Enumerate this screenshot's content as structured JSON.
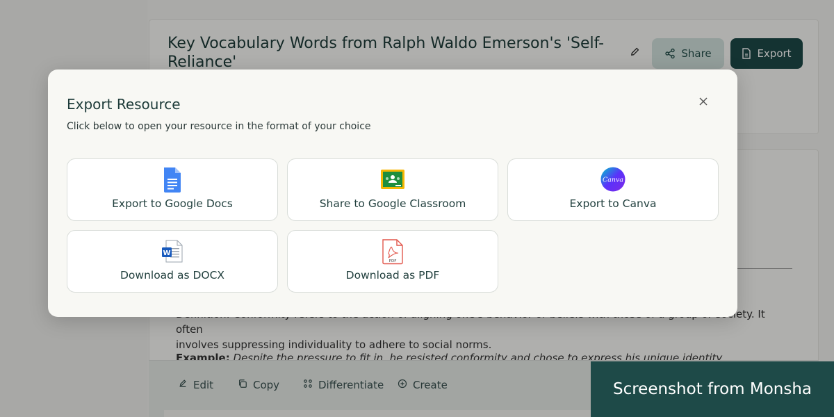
{
  "document": {
    "title": "Key Vocabulary Words from Ralph Waldo Emerson's 'Self-Reliance'",
    "share_label": "Share",
    "export_label": "Export"
  },
  "content": {
    "definition_line1": "Definition: Conformity refers to the action of aligning one's behavior or beliefs with those of a group or society. It often",
    "definition_line2": "involves suppressing individuality to adhere to social norms.",
    "example_label": "Example:",
    "example_text": "Despite the pressure to fit in, he resisted conformity and chose to express his unique identity."
  },
  "toolbar": {
    "items": [
      {
        "label": "Edit",
        "icon": "edit-icon"
      },
      {
        "label": "Copy",
        "icon": "copy-icon"
      },
      {
        "label": "Differentiate",
        "icon": "differentiate-icon"
      },
      {
        "label": "Create",
        "icon": "create-icon"
      }
    ]
  },
  "modal": {
    "title": "Export Resource",
    "subtitle": "Click below to open your resource in the format of your choice",
    "options": [
      {
        "label": "Export to Google Docs",
        "icon": "google-docs-icon"
      },
      {
        "label": "Share to Google Classroom",
        "icon": "google-classroom-icon"
      },
      {
        "label": "Export to Canva",
        "icon": "canva-icon"
      },
      {
        "label": "Download as DOCX",
        "icon": "word-docx-icon"
      },
      {
        "label": "Download as PDF",
        "icon": "pdf-icon"
      }
    ],
    "canva_logo_text": "Canva",
    "pdf_badge_text": "PDF",
    "word_badge_text": "W"
  },
  "watermark": {
    "text": "Screenshot from Monsha"
  },
  "colors": {
    "brand_dark": "#1e4a48",
    "brand_light": "#d3e3df",
    "modal_bg": "#f8f8f4"
  }
}
